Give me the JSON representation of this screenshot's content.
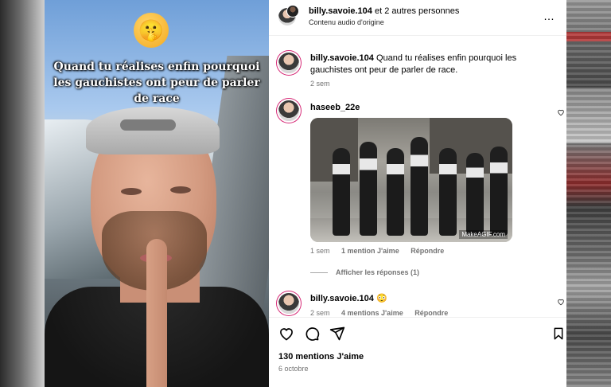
{
  "video": {
    "emoji": "🤫",
    "caption": "Quand tu réalises enfin pourquoi les gauchistes ont peur de parler de race"
  },
  "header": {
    "username": "billy.savoie.104",
    "collab_suffix": " et 2 autres personnes",
    "audio_label": "Contenu audio d'origine",
    "more_icon": "…"
  },
  "comments": [
    {
      "username": "billy.savoie.104",
      "text": "Quand tu réalises enfin pourquoi les gauchistes ont peur de parler de race.",
      "time": "2 sem"
    },
    {
      "username": "haseeb_22e",
      "gif_watermark": "MakeAGIF.com",
      "time": "1 sem",
      "likes": "1 mention J'aime",
      "reply": "Répondre",
      "view_replies": "Afficher les réponses (1)"
    },
    {
      "username": "billy.savoie.104",
      "text": "😳",
      "time": "2 sem",
      "likes": "4 mentions J'aime",
      "reply": "Répondre"
    }
  ],
  "actions": {
    "icons": [
      "heart-icon",
      "comment-icon",
      "share-icon",
      "save-icon"
    ]
  },
  "likes_total": "130 mentions J'aime",
  "post_date": "6 octobre"
}
